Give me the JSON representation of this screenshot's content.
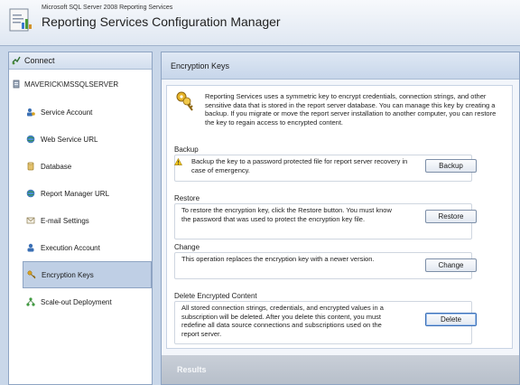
{
  "app": {
    "product": "Microsoft SQL Server 2008 Reporting Services",
    "title": "Reporting Services Configuration Manager"
  },
  "connect": {
    "label": "Connect"
  },
  "server": {
    "name": "MAVERICK\\MSSQLSERVER"
  },
  "nav": {
    "items": [
      {
        "label": "Service Account",
        "icon": "service-account-icon"
      },
      {
        "label": "Web Service URL",
        "icon": "globe-icon"
      },
      {
        "label": "Database",
        "icon": "database-icon"
      },
      {
        "label": "Report Manager URL",
        "icon": "globe-icon"
      },
      {
        "label": "E-mail Settings",
        "icon": "envelope-icon"
      },
      {
        "label": "Execution Account",
        "icon": "user-icon"
      },
      {
        "label": "Encryption Keys",
        "icon": "keys-icon",
        "selected": true
      },
      {
        "label": "Scale-out Deployment",
        "icon": "network-icon"
      }
    ]
  },
  "page": {
    "header": "Encryption Keys",
    "intro": "Reporting Services uses a symmetric key to encrypt credentials, connection strings, and other sensitive data that is stored in the report server database.  You can manage this key by creating a backup.  If you migrate or move the report server installation to another computer, you can restore the key to regain access to encrypted content.",
    "backup": {
      "legend": "Backup",
      "desc": "Backup the key to a password protected file for report server recovery in case of emergency.",
      "button": "Backup"
    },
    "restore": {
      "legend": "Restore",
      "desc": "To restore the encryption key, click the Restore button. You must know the password that was used to protect the encryption key file.",
      "button": "Restore"
    },
    "change": {
      "legend": "Change",
      "desc": "This operation replaces the encryption key with a newer version.",
      "button": "Change"
    },
    "delete": {
      "legend": "Delete Encrypted Content",
      "desc": "All stored connection strings, credentials, and encrypted values in a subscription will be deleted.  After you delete this content, you must redefine all data source connections and subscriptions used on the report server.",
      "button": "Delete"
    },
    "results": "Results"
  }
}
